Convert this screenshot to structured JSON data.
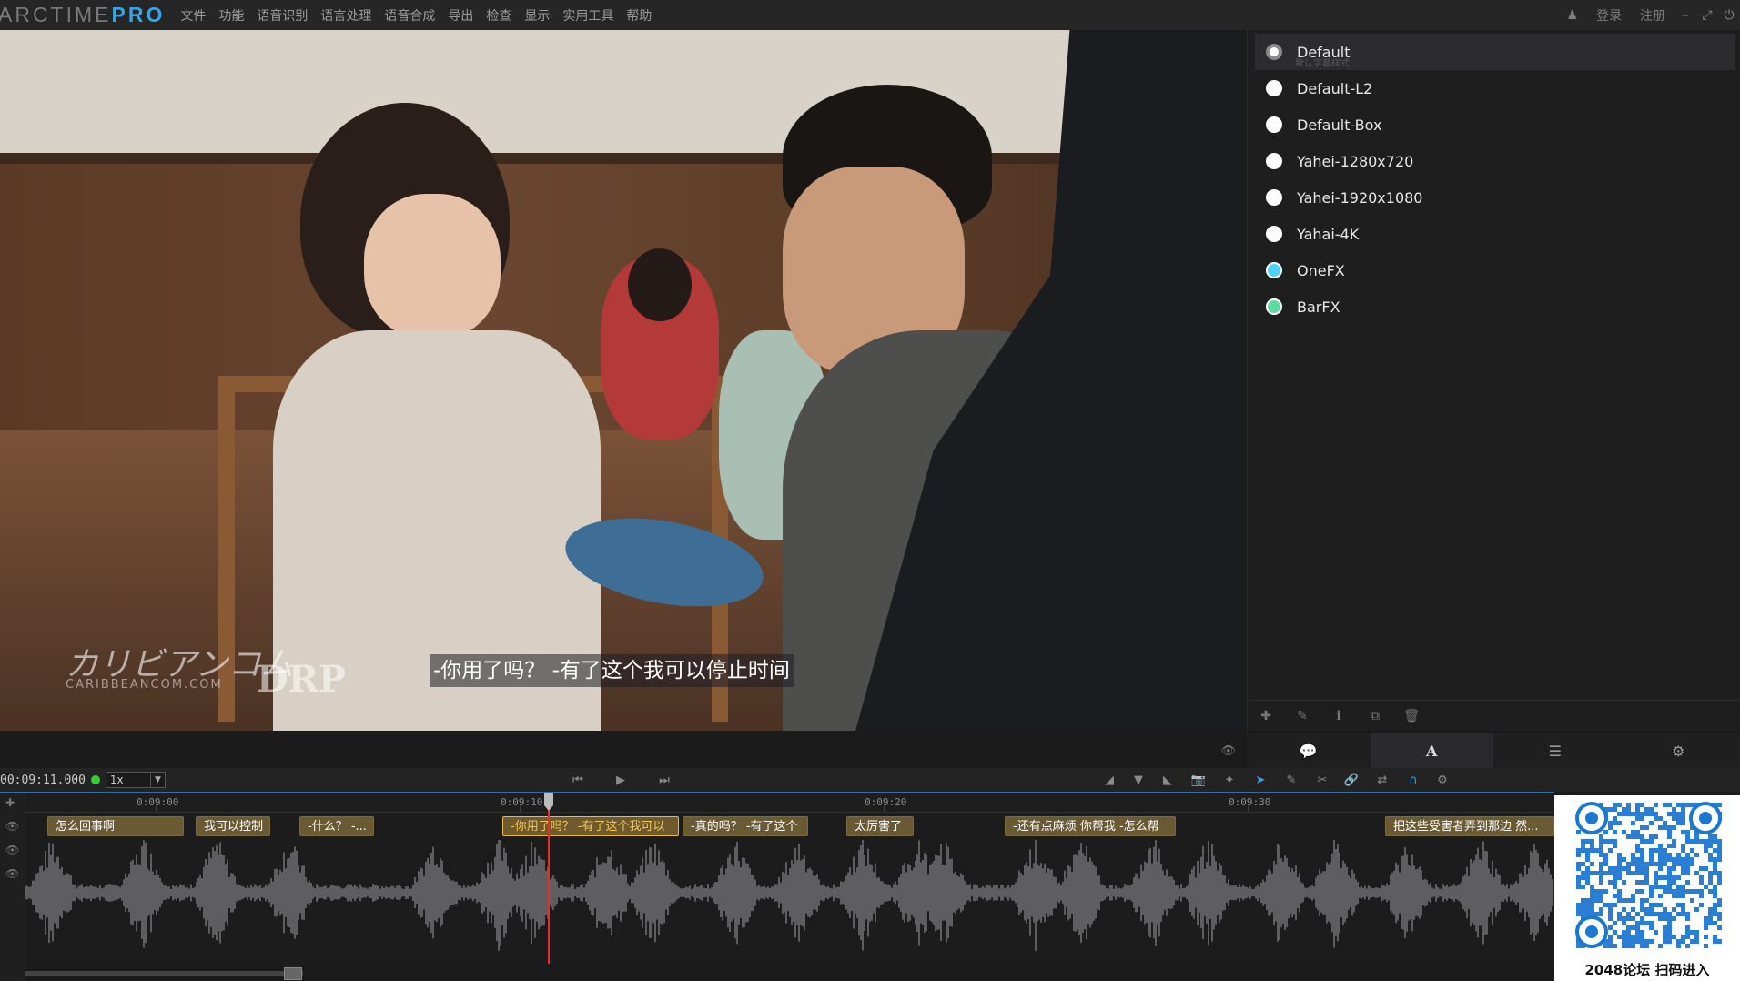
{
  "app": {
    "logo_main": "ARCTIME",
    "logo_pro": "PRO"
  },
  "menu": [
    "文件",
    "功能",
    "语音识别",
    "语言处理",
    "语音合成",
    "导出",
    "检查",
    "显示",
    "实用工具",
    "帮助"
  ],
  "account": {
    "login": "登录",
    "register": "注册"
  },
  "video": {
    "subtitle_overlay": "-你用了吗？ -有了这个我可以停止时间",
    "watermark_main": "カリビアンコム",
    "watermark_url": "CARIBBEANCOM.COM",
    "watermark_logo": "DRP"
  },
  "styles": {
    "items": [
      {
        "label": "Default",
        "sub": "默认字幕样式",
        "color": "#ffffff",
        "selected": true
      },
      {
        "label": "Default-L2",
        "color": "#ffffff"
      },
      {
        "label": "Default-Box",
        "color": "#ffffff"
      },
      {
        "label": "Yahei-1280x720",
        "color": "#ffffff"
      },
      {
        "label": "Yahei-1920x1080",
        "color": "#ffffff"
      },
      {
        "label": "Yahai-4K",
        "color": "#ffffff"
      },
      {
        "label": "OneFX",
        "color": "#4fd1ff"
      },
      {
        "label": "BarFX",
        "color": "#5fd9a0"
      }
    ]
  },
  "transport": {
    "timecode": "00:09:11.000",
    "speed": "1x"
  },
  "timeline": {
    "ticks": [
      "0:09:00",
      "0:09:10",
      "0:09:20",
      "0:09:30"
    ],
    "clips": [
      {
        "text": "怎么回事啊",
        "active": false
      },
      {
        "text": "我可以控制",
        "active": false
      },
      {
        "text": "-什么？ -...",
        "active": false
      },
      {
        "text": "-你用了吗？ -有了这个我可以",
        "active": true
      },
      {
        "text": "-真的吗？ -有了这个",
        "active": false
      },
      {
        "text": "太厉害了",
        "active": false
      },
      {
        "text": "-还有点麻烦 你帮我 -怎么帮",
        "active": false
      },
      {
        "text": "把这些受害者弄到那边 然...",
        "active": false
      }
    ]
  },
  "qr": {
    "caption": "2048论坛 扫码进入"
  },
  "colors": {
    "accent": "#3aa3e3",
    "playhead": "#e03030",
    "active_clip_border": "#e8b94a"
  }
}
